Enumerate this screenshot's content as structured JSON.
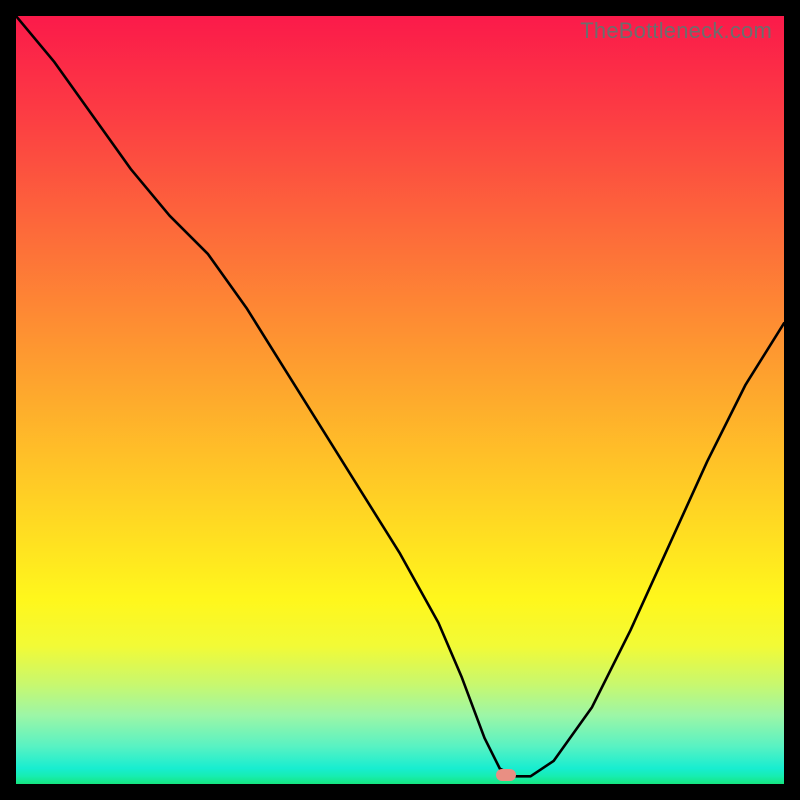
{
  "watermark": "TheBottleneck.com",
  "marker": {
    "x_pct": 63.8,
    "y_pct": 98.8,
    "color": "#e98f83"
  },
  "chart_data": {
    "type": "line",
    "title": "",
    "xlabel": "",
    "ylabel": "",
    "xlim": [
      0,
      100
    ],
    "ylim": [
      0,
      100
    ],
    "series": [
      {
        "name": "bottleneck-curve",
        "x": [
          0.0,
          5.0,
          10.0,
          15.0,
          20.0,
          25.0,
          30.0,
          35.0,
          40.0,
          45.0,
          50.0,
          55.0,
          58.0,
          61.0,
          63.0,
          65.0,
          67.0,
          70.0,
          75.0,
          80.0,
          85.0,
          90.0,
          95.0,
          100.0
        ],
        "y": [
          100.0,
          94.0,
          87.0,
          80.0,
          74.0,
          69.0,
          62.0,
          54.0,
          46.0,
          38.0,
          30.0,
          21.0,
          14.0,
          6.0,
          2.0,
          1.0,
          1.0,
          3.0,
          10.0,
          20.0,
          31.0,
          42.0,
          52.0,
          60.0
        ]
      }
    ],
    "annotations": [
      {
        "type": "marker",
        "x": 63.8,
        "y": 1.2,
        "label": "optimal-point"
      }
    ],
    "background_gradient_stops": [
      {
        "pct": 0,
        "color": "#fb1a4a"
      },
      {
        "pct": 12,
        "color": "#fc3a44"
      },
      {
        "pct": 28,
        "color": "#fd6a3a"
      },
      {
        "pct": 44,
        "color": "#fe9930"
      },
      {
        "pct": 60,
        "color": "#ffc826"
      },
      {
        "pct": 76,
        "color": "#fff71c"
      },
      {
        "pct": 82,
        "color": "#f2fa36"
      },
      {
        "pct": 87,
        "color": "#c8f86e"
      },
      {
        "pct": 91,
        "color": "#9df6a6"
      },
      {
        "pct": 95,
        "color": "#5af2c2"
      },
      {
        "pct": 98,
        "color": "#17edd0"
      },
      {
        "pct": 99,
        "color": "#17edb0"
      },
      {
        "pct": 100,
        "color": "#15e57f"
      }
    ]
  }
}
